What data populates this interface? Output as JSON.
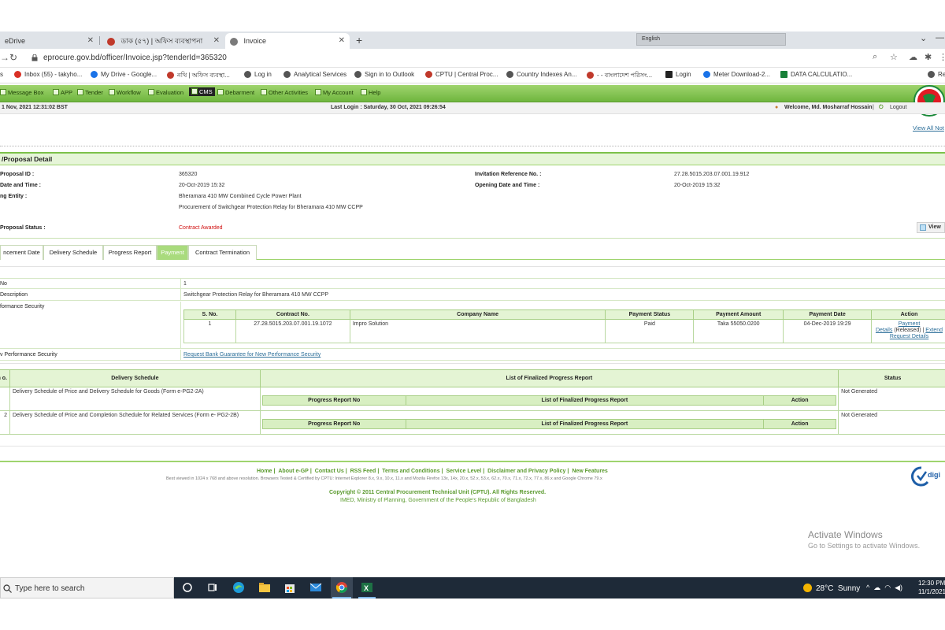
{
  "browser": {
    "tabs": [
      {
        "label": "eDrive",
        "close": "✕"
      },
      {
        "label": "ডাক (৫৭) | অফিস ব্যবস্থাপনা",
        "close": "✕"
      },
      {
        "label": "Invoice",
        "close": "✕"
      }
    ],
    "new_tab": "+",
    "ext_strip_text": "English",
    "url": "eprocure.gov.bd/officer/Invoice.jsp?tenderId=365320",
    "bookmarks": [
      {
        "label": "s",
        "color": "#888888"
      },
      {
        "label": "Inbox (55) - takyho...",
        "color": "#d93025"
      },
      {
        "label": "My Drive - Google...",
        "color": "#1a73e8"
      },
      {
        "label": "নথি | অফিস ব্যবস্থা...",
        "color": "#c0392b"
      },
      {
        "label": "Log in",
        "color": "#555555"
      },
      {
        "label": "Analytical Services",
        "color": "#555555"
      },
      {
        "label": "Sign in to Outlook",
        "color": "#555555"
      },
      {
        "label": "CPTU | Central Proc...",
        "color": "#c0392b"
      },
      {
        "label": "Country Indexes An...",
        "color": "#555555"
      },
      {
        "label": "- - বাংলাদেশ পরিসং...",
        "color": "#c0392b"
      },
      {
        "label": "Login",
        "color": "#222222"
      },
      {
        "label": "Meter Download-2...",
        "color": "#1a73e8"
      },
      {
        "label": "DATA CALCULATIO...",
        "color": "#188038"
      },
      {
        "label": "Re",
        "color": "#555555"
      }
    ]
  },
  "site": {
    "menu": [
      "Message Box",
      "APP",
      "Tender",
      "Workflow",
      "Evaluation",
      "CMS",
      "Debarment",
      "Other Activities",
      "My Account",
      "Help"
    ],
    "datetime": "1 Nov, 2021 12:31:02 BST",
    "last_login": "Last Login : Saturday, 30 Oct, 2021 09:26:54",
    "welcome": "Welcome, Md. Mosharraf Hossain",
    "separator": "|",
    "logout": "Logout",
    "view_all": "View All Not"
  },
  "detail": {
    "heading": "/Proposal Detail",
    "proposal_id_label": "Proposal ID :",
    "proposal_id": "365320",
    "invitation_ref_label": "Invitation Reference No. :",
    "invitation_ref": "27.28.5015.203.07.001.19.912",
    "date_time_label": "Date and Time :",
    "date_time": "20-Oct-2019 15:32",
    "opening_label": "Opening Date and Time :",
    "opening": "20-Oct-2019 15:32",
    "entity_label": "ng Entity :",
    "entity": "Bheramara 410 MW Combined Cycle Power Plant",
    "title": "Procurement of Switchgear Protection Relay for Bheramara 410 MW CCPP",
    "status_label": "Proposal Status :",
    "status": "Contract Awarded",
    "view_button": "View"
  },
  "tabs": [
    {
      "label": "ncement Date",
      "active": false
    },
    {
      "label": "Delivery Schedule",
      "active": false
    },
    {
      "label": "Progress Report",
      "active": false
    },
    {
      "label": "Payment",
      "active": true
    },
    {
      "label": "Contract Termination",
      "active": false
    }
  ],
  "info": {
    "no_label": "No",
    "no_value": "1",
    "desc_label": "Description",
    "desc_value": "Switchgear Protection Relay for Bheramara 410 MW CCPP",
    "perf_label": "formance Security",
    "new_perf_label": "v Performance Security",
    "new_perf_link": "Request Bank Guarantee for New Performance Security"
  },
  "perf_table": {
    "headers": [
      "S. No.",
      "Contract No.",
      "Company Name",
      "Payment Status",
      "Payment Amount",
      "Payment Date",
      "Action"
    ],
    "row": {
      "sno": "1",
      "contract": "27.28.5015.203.07.001.19.1072",
      "company": "Impro Solution",
      "status": "Paid",
      "amount": "Taka 55050.0200",
      "date": "04-Dec-2019 19:29",
      "action_payment": "Payment",
      "action_details": "Details",
      "action_released": "(Released) |",
      "action_extend": "Extend",
      "action_request": "Request Details"
    }
  },
  "sched_table": {
    "headers": [
      "m o.",
      "Delivery Schedule",
      "List of Finalized Progress Report",
      "Status"
    ],
    "sub_headers": [
      "Progress Report No",
      "List of Finalized Progress Report",
      "Action"
    ],
    "rows": [
      {
        "no": "",
        "schedule": "Delivery Schedule of Price and Delivery Schedule for Goods (Form e-PG2-2A)",
        "status": "Not Generated"
      },
      {
        "no": "2",
        "schedule": "Delivery Schedule of Price and Completion Schedule for Related Services (Form e- PG2-2B)",
        "status": "Not Generated"
      }
    ]
  },
  "footer": {
    "links": [
      "Home",
      "About e-GP",
      "Contact Us",
      "RSS Feed",
      "Terms and Conditions",
      "Service Level",
      "Disclaimer and Privacy Policy",
      "New Features"
    ],
    "note": "Best viewed in 1024 x 768 and above resolution. Browsers Tested & Certified by CPTU: Internet Explorer 8.x, 9.x, 10.x, 11.x and Mozila Firefox 13x, 14x, 20.x, 52.x, 53.x, 62.x, 70.x, 71.x, 72.x, 77.x, 86.x and Google Chrome 79.x",
    "copyright": "Copyright © 2011 Central Procurement Technical Unit (CPTU). All Rights Reserved.",
    "ministry": "IMED, Ministry of Planning, Government of the People's Republic of Bangladesh",
    "digicert": "digi"
  },
  "windows": {
    "activate_title": "Activate Windows",
    "activate_sub": "Go to Settings to activate Windows.",
    "search_placeholder": "Type here to search",
    "weather_temp": "28°C",
    "weather_desc": "Sunny",
    "time": "12:30 PM",
    "date": "11/1/2021"
  }
}
